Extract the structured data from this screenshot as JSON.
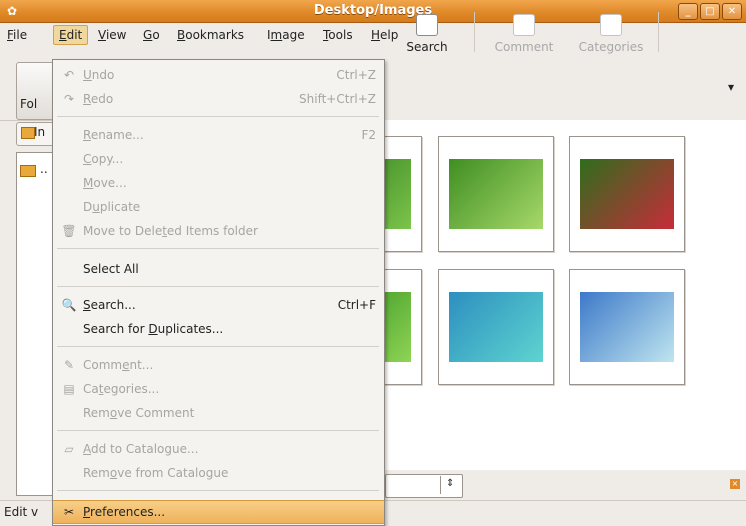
{
  "window": {
    "title": "Desktop/Images",
    "minimize": "_",
    "maximize": "□",
    "close": "✕",
    "icon": "gthumb-icon"
  },
  "menubar": [
    {
      "pre": "",
      "u": "F",
      "post": "ile"
    },
    {
      "pre": "",
      "u": "E",
      "post": "dit"
    },
    {
      "pre": "",
      "u": "V",
      "post": "iew"
    },
    {
      "pre": "",
      "u": "G",
      "post": "o"
    },
    {
      "pre": "",
      "u": "B",
      "post": "ookmarks"
    },
    {
      "pre": "I",
      "u": "m",
      "post": "age"
    },
    {
      "pre": "",
      "u": "T",
      "post": "ools"
    },
    {
      "pre": "",
      "u": "H",
      "post": "elp"
    }
  ],
  "toolbar": {
    "folders_label": "Fol",
    "search": "Search",
    "comment": "Comment",
    "categories": "Categories",
    "overflow": "▾"
  },
  "location_label": "In",
  "sidebar_item": "..",
  "status": {
    "text": "Edit v"
  },
  "edit_menu": {
    "undo": {
      "u": "U",
      "post": "ndo",
      "accel": "Ctrl+Z"
    },
    "redo": {
      "u": "R",
      "post": "edo",
      "accel": "Shift+Ctrl+Z"
    },
    "rename": {
      "u": "R",
      "post": "ename...",
      "accel": "F2"
    },
    "copy": {
      "u": "C",
      "post": "opy..."
    },
    "move": {
      "u": "M",
      "post": "ove..."
    },
    "duplicate": {
      "pre": "D",
      "u": "u",
      "post": "plicate"
    },
    "move_deleted": {
      "pre": "Move to Dele",
      "u": "t",
      "post": "ed Items folder"
    },
    "select_all": "Select All",
    "search": {
      "u": "S",
      "post": "earch...",
      "accel": "Ctrl+F"
    },
    "search_dups": {
      "pre": "Search for ",
      "u": "D",
      "post": "uplicates..."
    },
    "comment": {
      "pre": "Comm",
      "u": "e",
      "post": "nt..."
    },
    "categories": {
      "pre": "Ca",
      "u": "t",
      "post": "egories..."
    },
    "remove_comment": {
      "pre": "Rem",
      "u": "o",
      "post": "ve Comment"
    },
    "add_catalogue": {
      "u": "A",
      "post": "dd to Catalogue..."
    },
    "remove_catalogue": {
      "pre": "Rem",
      "u": "o",
      "post": "ve from Catalogue"
    },
    "preferences": {
      "u": "P",
      "post": "references..."
    }
  },
  "thumbnails": [
    {
      "name": "leaves-photo",
      "colors": [
        "#2d7a1f",
        "#7cc44a"
      ]
    },
    {
      "name": "butterfly-orange-photo",
      "colors": [
        "#3f8e22",
        "#a7d86a"
      ]
    },
    {
      "name": "butterfly-red-flowers-photo",
      "colors": [
        "#2f6d1d",
        "#c72c3a"
      ]
    },
    {
      "name": "green-leaf-photo",
      "colors": [
        "#2b8a1c",
        "#8fd455"
      ]
    },
    {
      "name": "reef-aerial-photo",
      "colors": [
        "#2d8fbf",
        "#5ed4d0"
      ]
    },
    {
      "name": "beach-photo",
      "colors": [
        "#3d79c9",
        "#bfe5ef"
      ]
    }
  ]
}
